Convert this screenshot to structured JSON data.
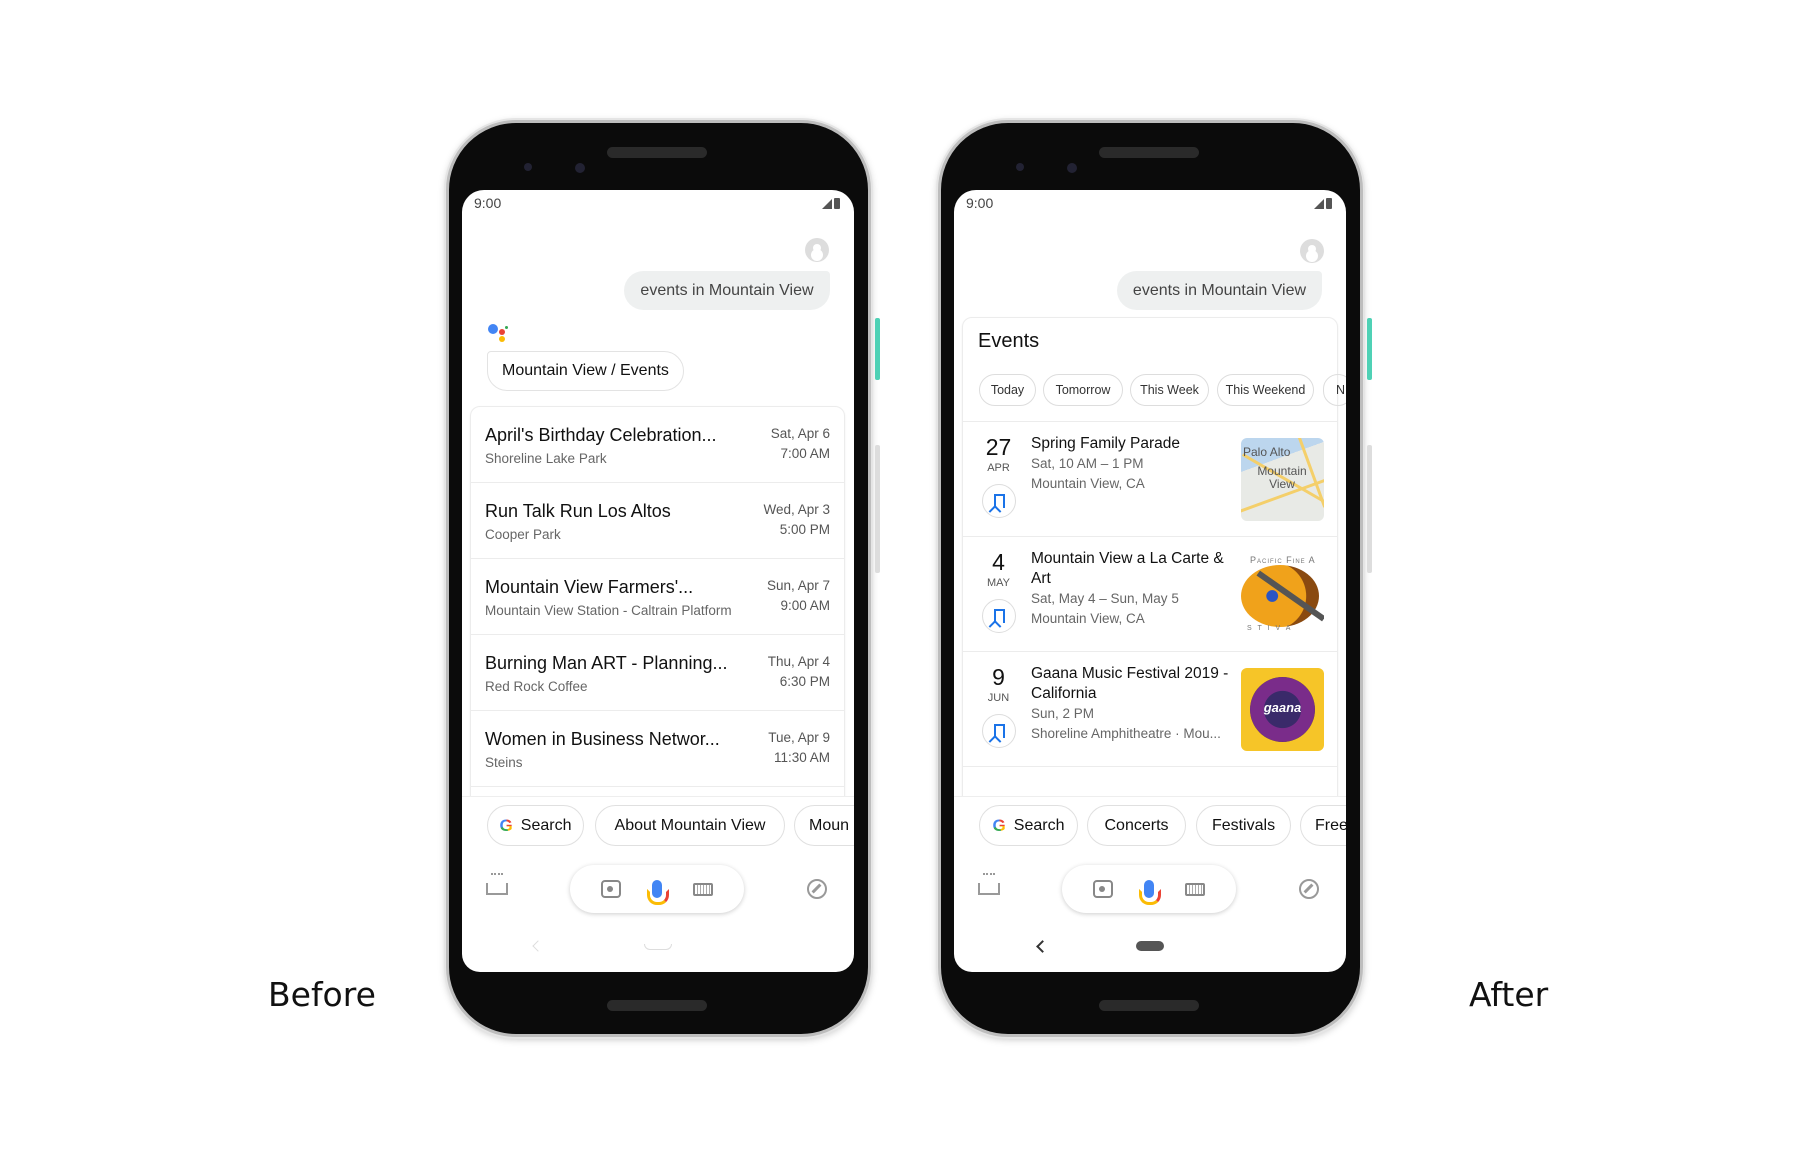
{
  "labels": {
    "before": "Before",
    "after": "After"
  },
  "before": {
    "status_time": "9:00",
    "query": "events in Mountain View",
    "breadcrumb": "Mountain View / Events",
    "events": [
      {
        "title": "April's Birthday Celebration...",
        "place": "Shoreline Lake Park",
        "date": "Sat, Apr 6",
        "time": "7:00 AM"
      },
      {
        "title": "Run Talk Run Los Altos",
        "place": "Cooper Park",
        "date": "Wed, Apr 3",
        "time": "5:00 PM"
      },
      {
        "title": "Mountain View Farmers'...",
        "place": "Mountain View Station - Caltrain Platform",
        "date": "Sun, Apr 7",
        "time": "9:00 AM"
      },
      {
        "title": "Burning Man ART - Planning...",
        "place": "Red Rock Coffee",
        "date": "Thu, Apr 4",
        "time": "6:30 PM"
      },
      {
        "title": "Women in Business Networ...",
        "place": "Steins",
        "date": "Tue, Apr 9",
        "time": "11:30 AM"
      }
    ],
    "suggestions": [
      "Search",
      "About Mountain View",
      "Moun"
    ]
  },
  "after": {
    "status_time": "9:00",
    "query": "events in Mountain View",
    "card_title": "Events",
    "filters": [
      "Today",
      "Tomorrow",
      "This Week",
      "This Weekend",
      "N"
    ],
    "events": [
      {
        "day": "27",
        "month": "APR",
        "title": "Spring Family Parade",
        "when": "Sat, 10 AM – 1 PM",
        "where": "Mountain View, CA",
        "image": "map",
        "image_text": [
          "Palo Alto",
          "Mountain View"
        ]
      },
      {
        "day": "4",
        "month": "MAY",
        "title": "Mountain View a La Carte & Art",
        "when": "Sat, May 4 – Sun, May 5",
        "where": "Mountain View, CA",
        "image": "art-festival",
        "image_text": [
          "Pacific Fine A",
          "S T I V A"
        ]
      },
      {
        "day": "9",
        "month": "JUN",
        "title": "Gaana Music Festival 2019 - California",
        "when": "Sun, 2 PM",
        "where": "Shoreline Amphitheatre · Mou...",
        "image": "gaana-poster",
        "image_text": [
          "gaana"
        ]
      }
    ],
    "suggestions": [
      "Search",
      "Concerts",
      "Festivals",
      "Free"
    ]
  },
  "icons": [
    "signal-icon",
    "battery-icon",
    "avatar-icon",
    "assistant-logo-icon",
    "google-g-icon",
    "updates-inbox-icon",
    "lens-icon",
    "mic-icon",
    "keyboard-icon",
    "compass-icon",
    "bookmark-icon",
    "back-icon",
    "home-icon"
  ],
  "colors": {
    "accent_blue": "#1a73e8",
    "side_button": "#4fd1b5",
    "query_bubble": "#eef0f0"
  }
}
